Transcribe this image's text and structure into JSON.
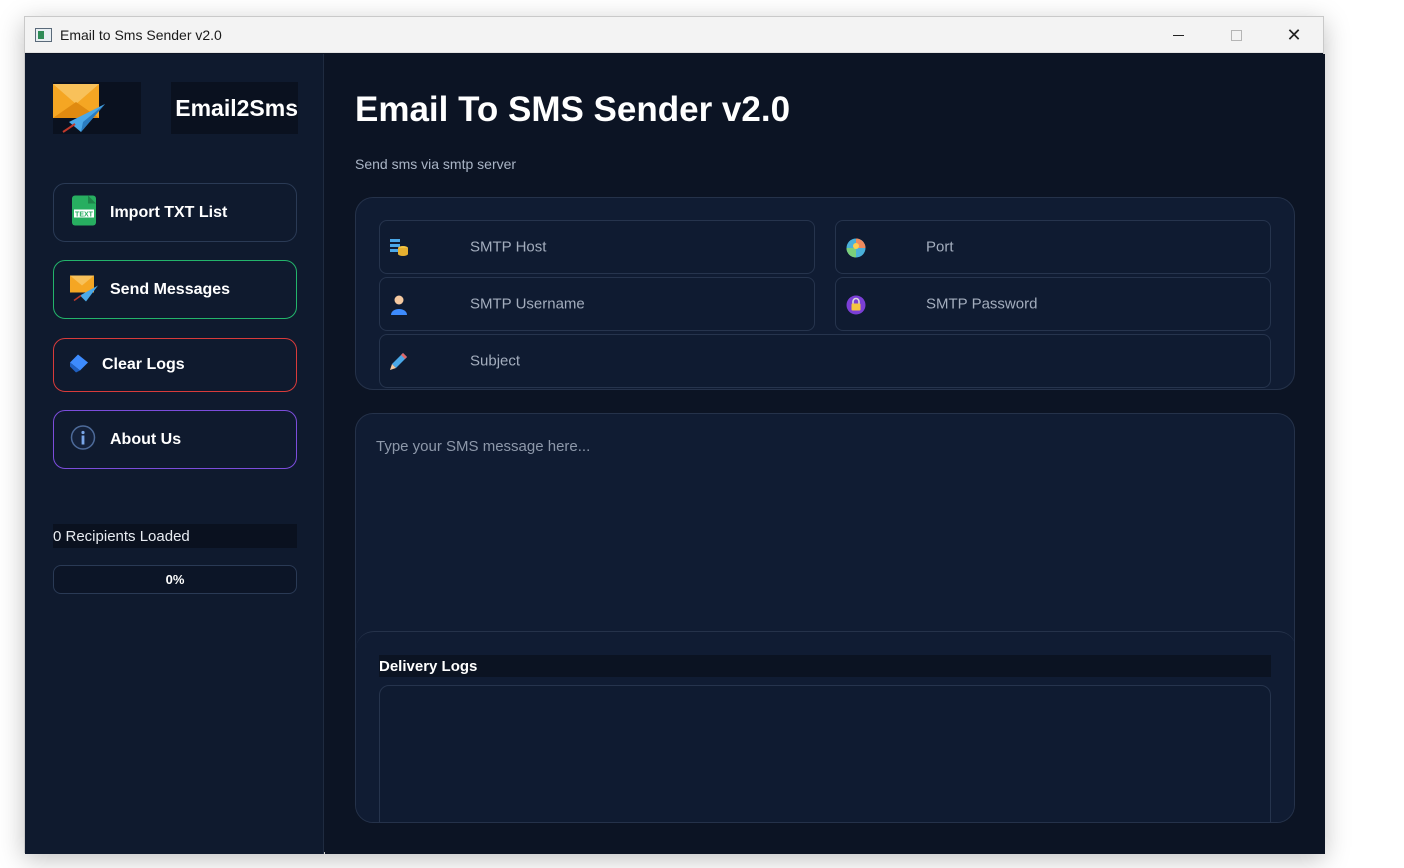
{
  "window": {
    "title": "Email to Sms Sender v2.0"
  },
  "sidebar": {
    "logo_text": "Email2Sms",
    "buttons": [
      {
        "label": "Import TXT List",
        "icon": "text-file-icon",
        "color": "#2a3a55"
      },
      {
        "label": "Send Messages",
        "icon": "email-send-icon",
        "color": "#23b46b"
      },
      {
        "label": "Clear Logs",
        "icon": "eraser-icon",
        "color": "#d83b3b"
      },
      {
        "label": "About Us",
        "icon": "info-icon",
        "color": "#7c4ddb"
      }
    ],
    "recipients_status": "0 Recipients Loaded",
    "progress": {
      "value": 0,
      "label": "0%"
    }
  },
  "main": {
    "title": "Email To SMS Sender v2.0",
    "subtitle": "Send sms via smtp server",
    "fields": {
      "host": {
        "placeholder": "SMTP Host",
        "icon": "server-icon"
      },
      "port": {
        "placeholder": "Port",
        "icon": "port-icon"
      },
      "username": {
        "placeholder": "SMTP Username",
        "icon": "user-icon"
      },
      "password": {
        "placeholder": "SMTP Password",
        "icon": "lock-icon"
      },
      "subject": {
        "placeholder": "Subject",
        "icon": "pencil-icon"
      }
    },
    "message_placeholder": "Type your SMS message here...",
    "logs_title": "Delivery Logs"
  },
  "colors": {
    "background": "#0c1424",
    "sidebar": "#0f1a2e",
    "card": "#101c33"
  }
}
